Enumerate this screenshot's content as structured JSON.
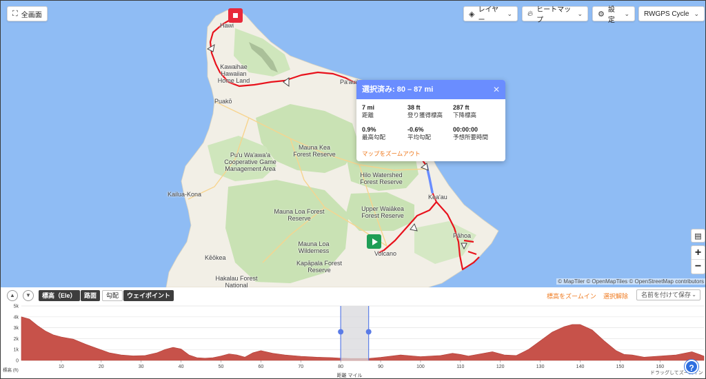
{
  "toolbar": {
    "fullscreen_label": "全画面",
    "layers_label": "レイヤー",
    "heatmap_label": "ヒートマップ",
    "settings_label": "設定",
    "basemap_label": "RWGPS Cycle"
  },
  "map": {
    "labels": {
      "hawi": "Hawi",
      "kawaihae": "Kawaihae Hawaiian Home Land",
      "paauilo": "Pa'auilo",
      "puako": "Puakō",
      "puuwaawaa": "Pu'u Wa'awa'a Cooperative Game Management Area",
      "maunakea": "Mauna Kea Forest Reserve",
      "hilo": "Hilo Watershed Forest Reserve",
      "kailua": "Kailua-Kona",
      "keaau": "Kea'au",
      "maunaloa_fr": "Mauna Loa Forest Reserve",
      "waiakea": "Upper Waiākea Forest Reserve",
      "pahoa": "Pāhoa",
      "maunaloa_w": "Mauna Loa Wilderness",
      "volcano": "Volcano",
      "keokea": "Kēōkea",
      "kapapala": "Kapāpala Forest Reserve",
      "hakalau": "Hakalau Forest National"
    },
    "attribution": "© MapTiler © OpenMapTiles © OpenStreetMap contributors",
    "start_icon": "play-icon",
    "end_icon": "stop-icon",
    "colors": {
      "water": "#8fbcf4",
      "land": "#f2efe6",
      "forest": "#c9e2b4",
      "route": "#e8121c",
      "selection": "#6a8dff"
    }
  },
  "popup": {
    "title": "選択済み: 80 – 87 mi",
    "stats": [
      {
        "value": "7 mi",
        "label": "距離"
      },
      {
        "value": "38 ft",
        "label": "登り獲得標高"
      },
      {
        "value": "287 ft",
        "label": "下降標高"
      },
      {
        "value": "0.9%",
        "label": "最高勾配"
      },
      {
        "value": "-0.6%",
        "label": "平均勾配"
      },
      {
        "value": "00:00:00",
        "label": "予想所要時間"
      }
    ],
    "zoom_out_label": "マップをズームアウト"
  },
  "elevation_panel": {
    "tabs": [
      "標高（Ele）",
      "路面",
      "勾配",
      "ウェイポイント"
    ],
    "zoom_in_label": "標高をズームイン",
    "clear_selection_label": "選択解除",
    "save_label": "名前を付けて保存",
    "help_label": "?",
    "drag_hint": "ドラッグしてズームイン",
    "y_axis_title": "標高 (ft)",
    "x_axis_title": "距離 マイル"
  },
  "chart_data": {
    "type": "area",
    "title": "",
    "xlabel": "距離 マイル",
    "ylabel": "標高 (ft)",
    "xlim": [
      0,
      171
    ],
    "ylim": [
      0,
      5000
    ],
    "x_ticks": [
      10,
      20,
      30,
      40,
      50,
      60,
      70,
      80,
      90,
      100,
      110,
      120,
      130,
      140,
      150,
      160
    ],
    "y_ticks": [
      {
        "value": 0,
        "label": "0"
      },
      {
        "value": 1000,
        "label": "1k"
      },
      {
        "value": 2000,
        "label": "2k"
      },
      {
        "value": 3000,
        "label": "3k"
      },
      {
        "value": 4000,
        "label": "4k"
      },
      {
        "value": 5000,
        "label": "5k"
      }
    ],
    "selection": [
      80,
      87
    ],
    "series": [
      {
        "x": [
          0,
          2,
          4,
          6,
          8,
          10,
          13,
          16,
          19,
          22,
          25,
          28,
          31,
          34,
          36,
          38,
          40,
          42,
          44,
          46,
          48,
          50,
          52,
          54,
          56,
          58,
          60,
          63,
          66,
          70,
          74,
          78,
          80,
          83,
          87,
          90,
          95,
          100,
          105,
          108,
          110,
          112,
          115,
          118,
          121,
          124,
          127,
          130,
          133,
          136,
          138,
          140,
          143,
          146,
          149,
          151,
          153,
          156,
          160,
          164,
          168,
          171
        ],
        "values": [
          4000,
          3800,
          3200,
          2700,
          2350,
          2150,
          1950,
          1500,
          1100,
          700,
          500,
          420,
          450,
          700,
          1000,
          1200,
          1050,
          500,
          250,
          200,
          250,
          400,
          600,
          500,
          300,
          700,
          900,
          650,
          500,
          380,
          300,
          250,
          200,
          180,
          180,
          280,
          500,
          350,
          450,
          650,
          550,
          400,
          600,
          800,
          500,
          450,
          1000,
          1800,
          2600,
          3100,
          3300,
          3300,
          2800,
          1800,
          900,
          550,
          500,
          300,
          400,
          500,
          800,
          400
        ]
      }
    ],
    "grid": true,
    "legend": "none"
  }
}
